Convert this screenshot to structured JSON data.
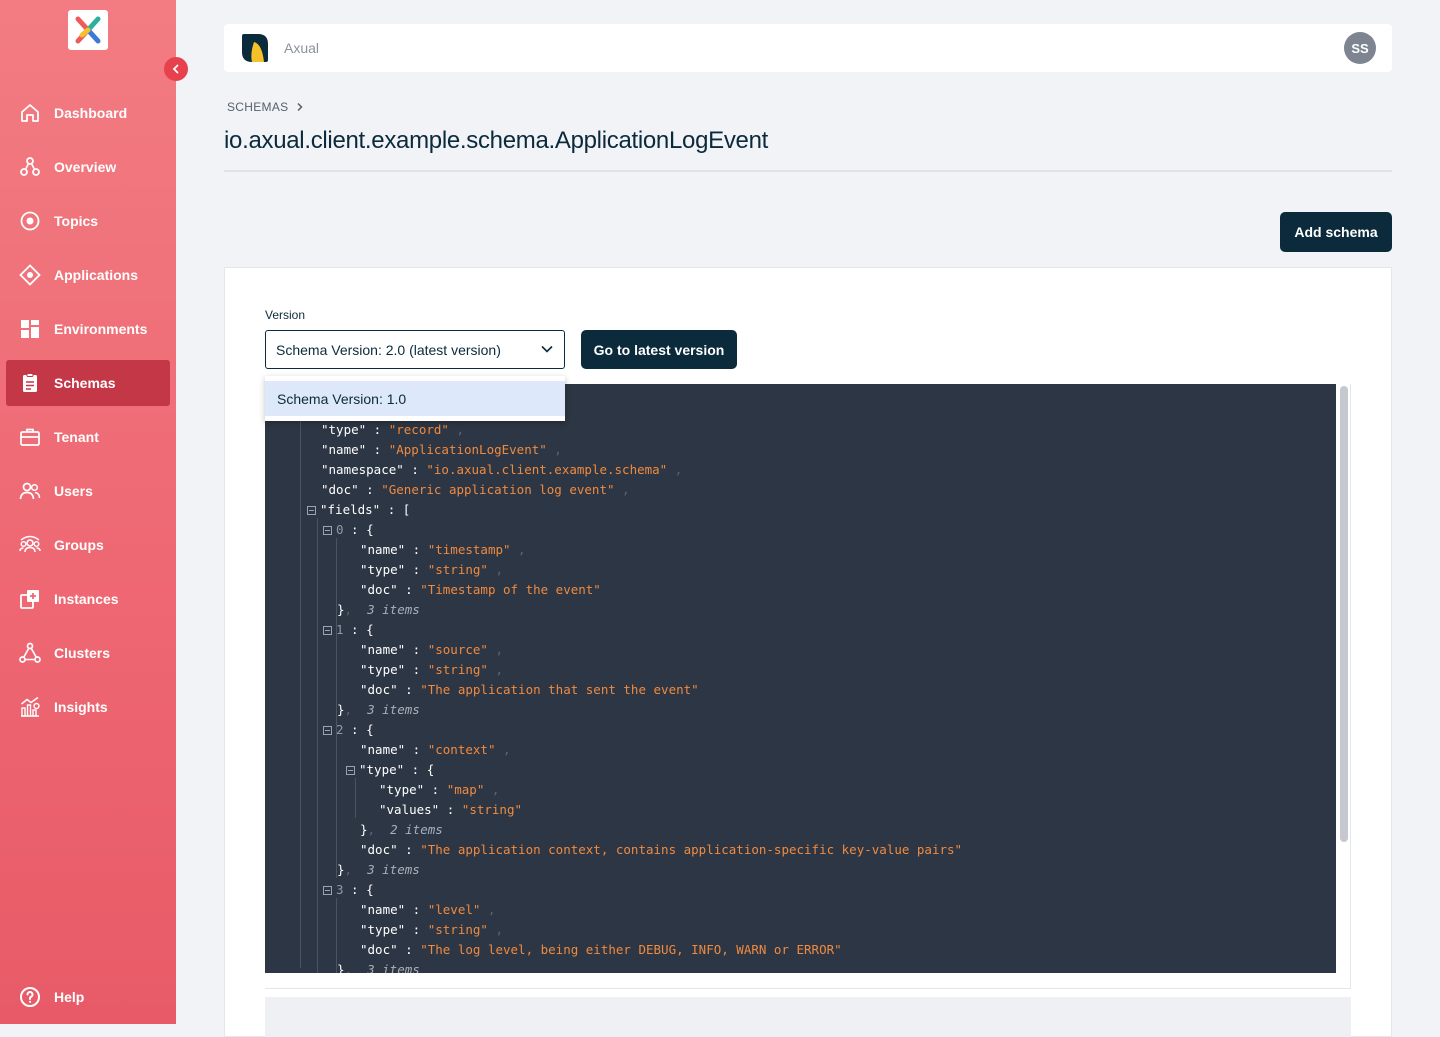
{
  "sidebar": {
    "items": [
      {
        "label": "Dashboard",
        "icon": "home-icon"
      },
      {
        "label": "Overview",
        "icon": "overview-icon"
      },
      {
        "label": "Topics",
        "icon": "topics-icon"
      },
      {
        "label": "Applications",
        "icon": "applications-icon"
      },
      {
        "label": "Environments",
        "icon": "environments-icon"
      },
      {
        "label": "Schemas",
        "icon": "schemas-icon",
        "active": true
      },
      {
        "label": "Tenant",
        "icon": "tenant-icon"
      },
      {
        "label": "Users",
        "icon": "users-icon"
      },
      {
        "label": "Groups",
        "icon": "groups-icon"
      },
      {
        "label": "Instances",
        "icon": "instances-icon"
      },
      {
        "label": "Clusters",
        "icon": "clusters-icon"
      },
      {
        "label": "Insights",
        "icon": "insights-icon"
      }
    ],
    "help_label": "Help"
  },
  "header": {
    "tenant_name": "Axual",
    "avatar_initials": "SS"
  },
  "breadcrumb": {
    "label": "SCHEMAS"
  },
  "page": {
    "title": "io.axual.client.example.schema.ApplicationLogEvent",
    "add_schema_label": "Add schema"
  },
  "version": {
    "label": "Version",
    "selected": "Schema Version: 2.0 (latest version)",
    "go_latest_label": "Go to latest version",
    "options": [
      "Schema Version: 1.0"
    ]
  },
  "schema_view": {
    "lines": [
      {
        "indent": 0,
        "key": "\"type\"",
        "value": "\"record\"",
        "comma": true
      },
      {
        "indent": 0,
        "key": "\"name\"",
        "value": "\"ApplicationLogEvent\"",
        "comma": true
      },
      {
        "indent": 0,
        "key": "\"namespace\"",
        "value": "\"io.axual.client.example.schema\"",
        "comma": true
      },
      {
        "indent": 0,
        "key": "\"doc\"",
        "value": "\"Generic application log event\"",
        "comma": true
      },
      {
        "indent": 0,
        "toggle": true,
        "key": "\"fields\"",
        "open": "["
      },
      {
        "indent": 1,
        "toggle": true,
        "index": "0",
        "open": "{"
      },
      {
        "indent": 2,
        "key": "\"name\"",
        "value": "\"timestamp\"",
        "comma": true
      },
      {
        "indent": 2,
        "key": "\"type\"",
        "value": "\"string\"",
        "comma": true
      },
      {
        "indent": 2,
        "key": "\"doc\"",
        "value": "\"Timestamp of the event\""
      },
      {
        "indent": 1,
        "close": "}",
        "meta": "3 items"
      },
      {
        "indent": 1,
        "toggle": true,
        "index": "1",
        "open": "{"
      },
      {
        "indent": 2,
        "key": "\"name\"",
        "value": "\"source\"",
        "comma": true
      },
      {
        "indent": 2,
        "key": "\"type\"",
        "value": "\"string\"",
        "comma": true
      },
      {
        "indent": 2,
        "key": "\"doc\"",
        "value": "\"The application that sent the event\""
      },
      {
        "indent": 1,
        "close": "}",
        "meta": "3 items"
      },
      {
        "indent": 1,
        "toggle": true,
        "index": "2",
        "open": "{"
      },
      {
        "indent": 2,
        "key": "\"name\"",
        "value": "\"context\"",
        "comma": true
      },
      {
        "indent": 2,
        "toggle": true,
        "key": "\"type\"",
        "open": "{"
      },
      {
        "indent": 3,
        "key": "\"type\"",
        "value": "\"map\"",
        "comma": true
      },
      {
        "indent": 3,
        "key": "\"values\"",
        "value": "\"string\""
      },
      {
        "indent": 2,
        "close": "}",
        "meta": "2 items"
      },
      {
        "indent": 2,
        "key": "\"doc\"",
        "value": "\"The application context, contains application-specific key-value pairs\""
      },
      {
        "indent": 1,
        "close": "}",
        "meta": "3 items"
      },
      {
        "indent": 1,
        "toggle": true,
        "index": "3",
        "open": "{"
      },
      {
        "indent": 2,
        "key": "\"name\"",
        "value": "\"level\"",
        "comma": true
      },
      {
        "indent": 2,
        "key": "\"type\"",
        "value": "\"string\"",
        "comma": true
      },
      {
        "indent": 2,
        "key": "\"doc\"",
        "value": "\"The log level, being either DEBUG, INFO, WARN or ERROR\""
      },
      {
        "indent": 1,
        "close": "}",
        "meta": "3 items"
      }
    ]
  },
  "colors": {
    "sidebar_top": "#f27c82",
    "sidebar_bottom": "#e85a67",
    "active_item": "#c43747",
    "primary_dark": "#0b2a3c",
    "code_bg": "#2d3644",
    "code_string": "#f08a3f"
  }
}
